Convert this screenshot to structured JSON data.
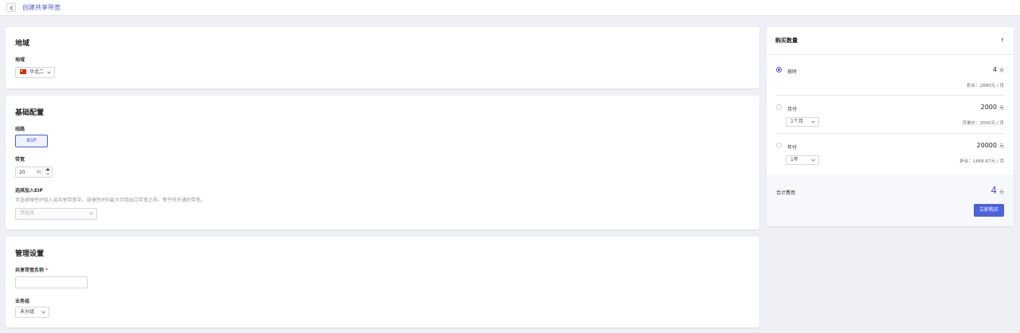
{
  "header": {
    "title": "创建共享带宽"
  },
  "region_card": {
    "title": "地域",
    "region_label": "地域",
    "region_value": "华北二"
  },
  "basic_card": {
    "title": "基础配置",
    "line_label": "线路",
    "line_option": "BGP",
    "bandwidth_label": "带宽",
    "bandwidth_value": "20",
    "bandwidth_unit": "M",
    "eip_label": "选择加入EIP",
    "eip_hint": "可选择弹性IP加入该共享带宽中，该弹性IP的最大可用出口带宽之和，等于所开通的带宽。",
    "eip_placeholder": "请选择"
  },
  "manage_card": {
    "title": "管理设置",
    "name_label": "共享带宽名称",
    "required_mark": "*",
    "group_label": "业务组",
    "group_value": "未分组"
  },
  "purchase": {
    "title": "购买数量",
    "collapse_icon": "↑",
    "options": [
      {
        "label": "按时",
        "price": "4",
        "unit": "元",
        "note": "折合：2880元 / 月",
        "selected": true
      },
      {
        "label": "月付",
        "price": "2000",
        "unit": "元",
        "period": "1个月",
        "note": "月单价：2000元 / 月",
        "selected": false
      },
      {
        "label": "年付",
        "price": "20000",
        "unit": "元",
        "period": "1年",
        "note": "折合：1666.67元 / 月",
        "selected": false
      }
    ],
    "total_label": "合计费用",
    "total_value": "4",
    "total_unit": "元",
    "buy_button": "立即购买"
  },
  "colors": {
    "accent": "#4c5fd6",
    "required": "#e0494f"
  }
}
